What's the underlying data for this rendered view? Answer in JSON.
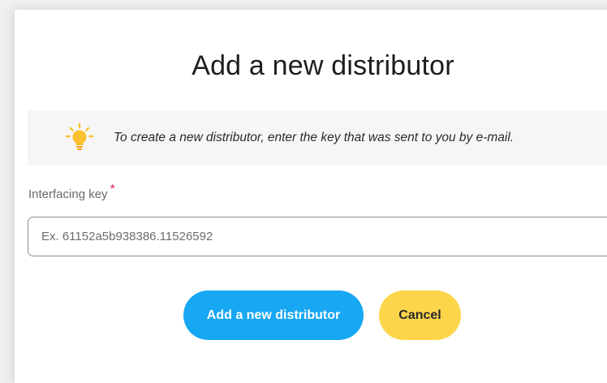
{
  "dialog": {
    "title": "Add a new distributor",
    "hint": {
      "icon": "lightbulb-icon",
      "text": "To create a new distributor, enter the key that was sent to you by e-mail."
    },
    "field": {
      "label": "Interfacing key",
      "required_mark": "*",
      "placeholder": "Ex. 61152a5b938386.11526592",
      "value": ""
    },
    "buttons": {
      "submit_label": "Add a new distributor",
      "cancel_label": "Cancel"
    }
  },
  "colors": {
    "primary": "#17a7f3",
    "cancel": "#fdd54b",
    "bulb": "#fbc02d",
    "required": "#e0245e"
  }
}
